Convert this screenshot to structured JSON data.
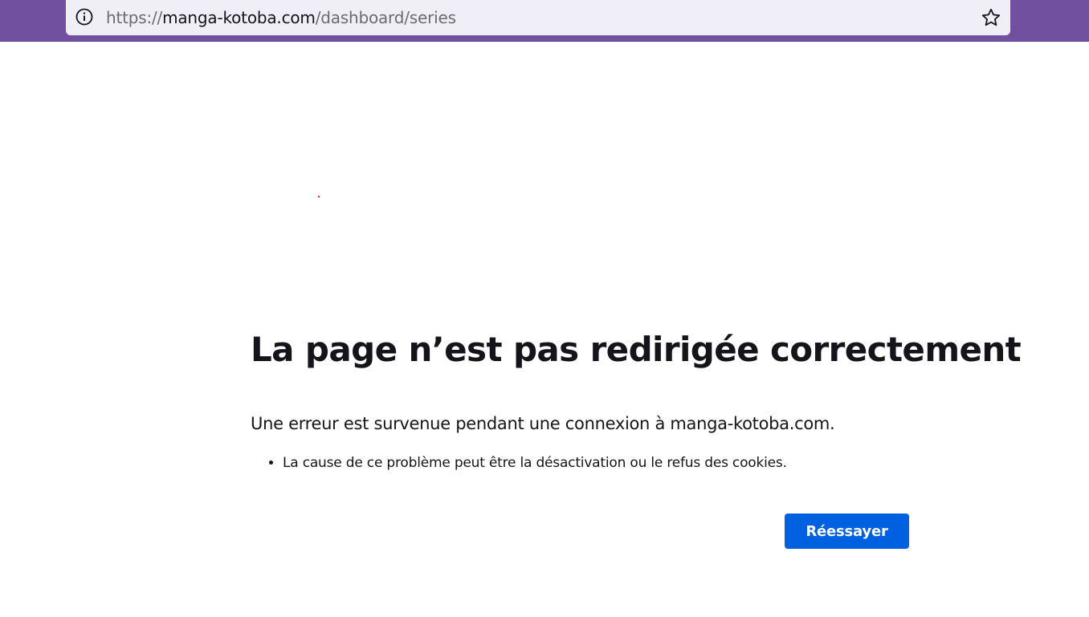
{
  "browser": {
    "url": {
      "scheme": "https://",
      "host": "manga-kotoba.com",
      "path": "/dashboard/series"
    },
    "icons": {
      "site_info": "info-circle-icon",
      "bookmark": "star-outline-icon"
    },
    "colors": {
      "toolbar": "#7150a0",
      "urlbar": "#f0eef6"
    }
  },
  "error": {
    "title": "La page n’est pas redirigée correctement",
    "description": "Une erreur est survenue pendant une connexion à manga-kotoba.com.",
    "reasons": [
      "La cause de ce problème peut être la désactivation ou le refus des cookies."
    ],
    "retry_label": "Réessayer",
    "colors": {
      "button": "#0061e0",
      "text": "#15141a"
    }
  }
}
